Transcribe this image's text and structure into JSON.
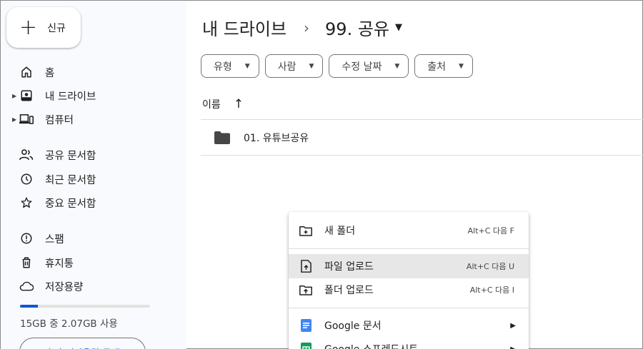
{
  "sidebar": {
    "new_label": "신규",
    "nav": {
      "home": "홈",
      "my_drive": "내 드라이브",
      "computers": "컴퓨터",
      "shared": "공유 문서함",
      "recent": "최근 문서함",
      "starred": "중요 문서함",
      "spam": "스팸",
      "trash": "휴지통",
      "storage": "저장용량"
    },
    "storage_text": "15GB 중 2.07GB 사용",
    "storage_fraction": 0.138,
    "buy_label": "추가 저장용량 구매"
  },
  "breadcrumb": {
    "root": "내 드라이브",
    "separator": "›",
    "current": "99. 공유"
  },
  "filters": {
    "type": "유형",
    "people": "사람",
    "modified": "수정 날짜",
    "source": "출처"
  },
  "list": {
    "name_header": "이름",
    "items": [
      {
        "name": "01. 유튜브공유",
        "icon": "folder-icon"
      }
    ]
  },
  "context_menu": {
    "new_folder": {
      "label": "새 폴더",
      "shortcut": "Alt+C 다음 F"
    },
    "file_upload": {
      "label": "파일 업로드",
      "shortcut": "Alt+C 다음 U"
    },
    "folder_upload": {
      "label": "폴더 업로드",
      "shortcut": "Alt+C 다음 I"
    },
    "google_docs": {
      "label": "Google 문서"
    },
    "google_sheets": {
      "label": "Google 스프레드시트"
    }
  },
  "colors": {
    "accent": "#0b57d0",
    "docs_blue": "#4285f4",
    "sheets_green": "#0f9d58",
    "sidebar_bg": "#f8fafd",
    "menu_hover": "#e7e7e7"
  }
}
